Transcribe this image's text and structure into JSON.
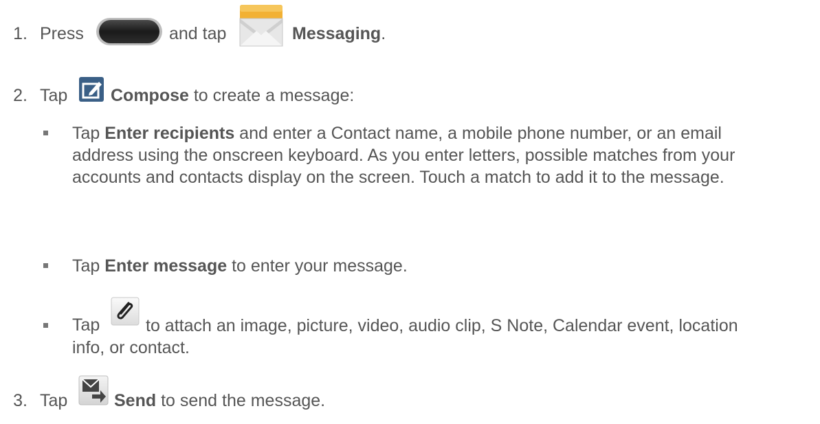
{
  "steps": [
    {
      "number": "1.",
      "pre": "Press",
      "mid": "and tap",
      "bold": "Messaging",
      "post": "."
    },
    {
      "number": "2.",
      "pre": "Tap",
      "bold": "Compose",
      "post": "to create a message:"
    },
    {
      "number": "3.",
      "pre": "Tap",
      "bold": "Send",
      "post": "to send the message."
    }
  ],
  "bullets": [
    {
      "pre": "Tap",
      "bold": "Enter recipients",
      "post": "and enter a Contact name, a mobile phone number, or an email address using the onscreen keyboard. As you enter letters, possible matches from your accounts and contacts display on the screen. Touch a match to add it to the message."
    },
    {
      "pre": "Tap",
      "bold": "Enter message",
      "post": "to enter your message."
    },
    {
      "pre": "Tap",
      "post": "to attach an image, picture, video, audio clip, S Note, Calendar event, location info, or contact."
    }
  ],
  "icons": {
    "home": "home-button-icon",
    "messaging": "messaging-envelope-icon",
    "compose": "compose-icon",
    "attach": "paperclip-icon",
    "send": "send-icon"
  },
  "colors": {
    "text": "#555555",
    "envelope_top": "#f2b134",
    "compose_bg": "#3a5f86"
  }
}
